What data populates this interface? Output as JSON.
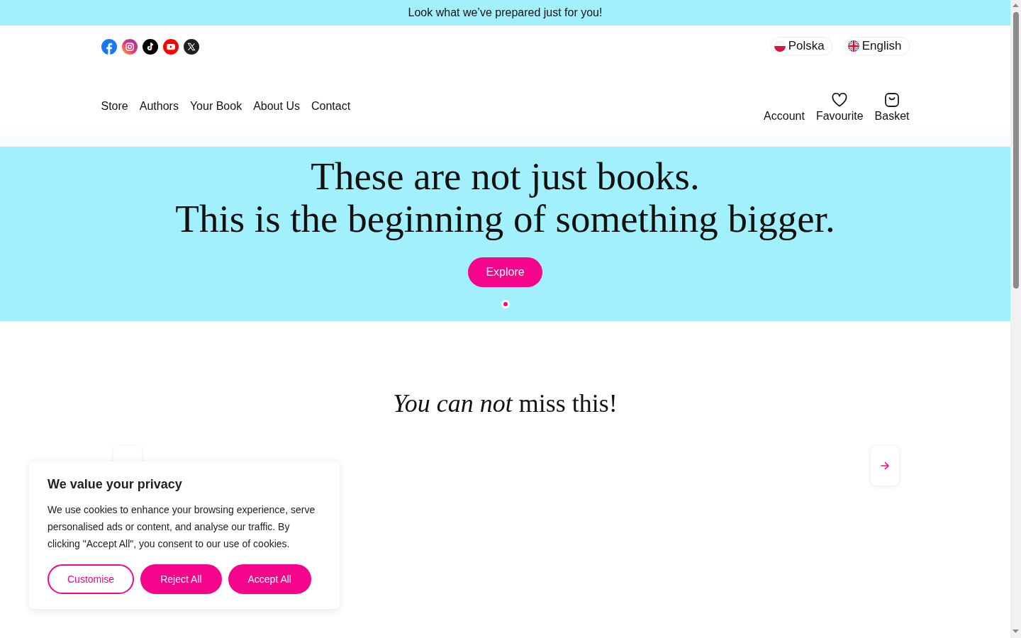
{
  "announcement": "Look what we’ve prepared just for you!",
  "languages": [
    {
      "label": "Polska"
    },
    {
      "label": "English"
    }
  ],
  "nav": {
    "links": [
      "Store",
      "Authors",
      "Your Book",
      "About Us",
      "Contact"
    ],
    "account_links": [
      "Account",
      "Favourite",
      "Basket"
    ]
  },
  "hero": {
    "headline": [
      "These are not just books.",
      "This is the beginning of something bigger."
    ],
    "button": "Explore",
    "slides": [
      {
        "selected": true
      }
    ]
  },
  "section": {
    "title": "*You can not* miss this!"
  },
  "cookie_banner": {
    "title": "We value your privacy",
    "text": "We use cookies to enhance your browsing experience, serve personalised ads or content, and analyse our traffic. By clicking \"Accept All\", you consent to our use of cookies.",
    "buttons": [
      {
        "label": "Customise",
        "kind": "outline"
      },
      {
        "label": "Reject All",
        "kind": "filled"
      },
      {
        "label": "Accept All",
        "kind": "filled"
      }
    ]
  }
}
